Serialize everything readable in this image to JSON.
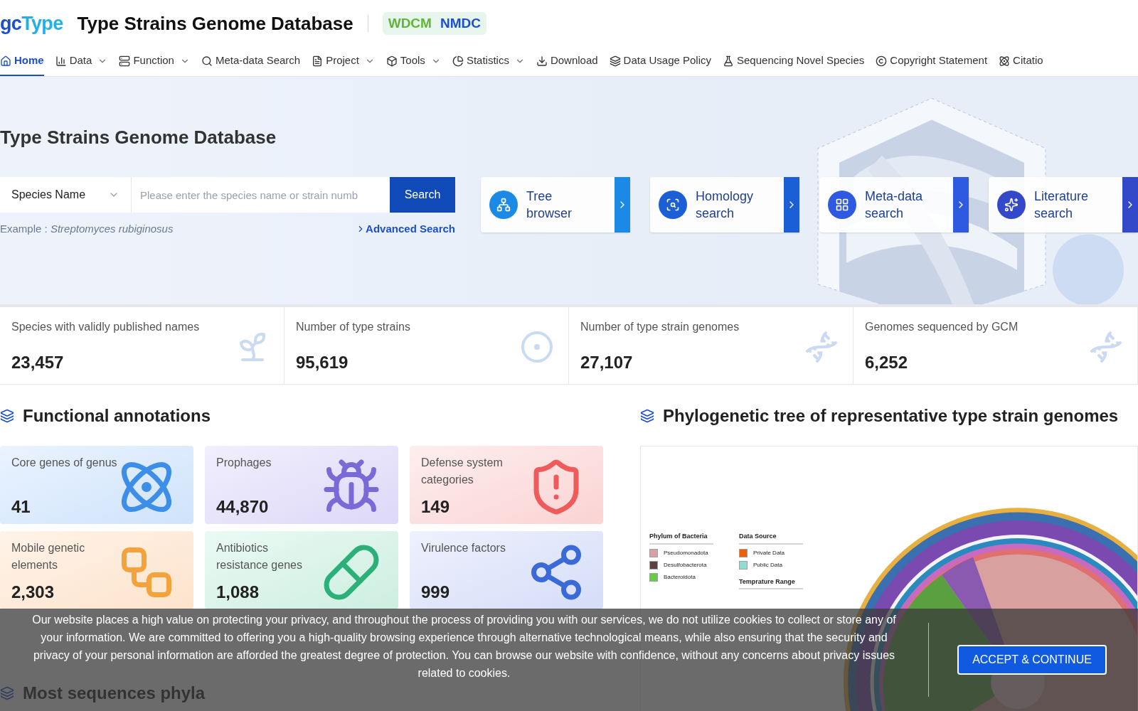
{
  "brand": {
    "logo_a": "gc",
    "logo_b": "Type",
    "title": "Type Strains Genome Database",
    "badges": [
      "WDCM",
      "NMDC"
    ]
  },
  "nav": [
    {
      "label": "Home",
      "dropdown": false,
      "selected": true
    },
    {
      "label": "Data",
      "dropdown": true,
      "selected": false
    },
    {
      "label": "Function",
      "dropdown": true,
      "selected": false
    },
    {
      "label": "Meta-data Search",
      "dropdown": false,
      "selected": false
    },
    {
      "label": "Project",
      "dropdown": true,
      "selected": false
    },
    {
      "label": "Tools",
      "dropdown": true,
      "selected": false
    },
    {
      "label": "Statistics",
      "dropdown": true,
      "selected": false
    },
    {
      "label": "Download",
      "dropdown": false,
      "selected": false
    },
    {
      "label": "Data Usage Policy",
      "dropdown": false,
      "selected": false
    },
    {
      "label": "Sequencing Novel Species",
      "dropdown": false,
      "selected": false
    },
    {
      "label": "Copyright Statement",
      "dropdown": false,
      "selected": false
    },
    {
      "label": "Citatio",
      "dropdown": false,
      "selected": false
    }
  ],
  "hero": {
    "title": "Type Strains Genome Database",
    "search_type": "Species Name",
    "placeholder": "Please enter the species name or strain numb",
    "search_button": "Search",
    "example_label": "Example : ",
    "example": "Streptomyces rubiginosus",
    "advanced": "Advanced Search"
  },
  "shortcuts": [
    {
      "label": "Tree browser",
      "color": "#1a8ae6"
    },
    {
      "label": "Homology search",
      "color": "#1a5fd6"
    },
    {
      "label": "Meta-data search",
      "color": "#2d5ae0"
    },
    {
      "label": "Literature search",
      "color": "#3349c9"
    }
  ],
  "stats": [
    {
      "label": "Species with validly published names",
      "value": "23,457"
    },
    {
      "label": "Number of type strains",
      "value": "95,619"
    },
    {
      "label": "Number of type strain genomes",
      "value": "27,107"
    },
    {
      "label": "Genomes sequenced by GCM",
      "value": "6,252"
    }
  ],
  "functional": {
    "title": "Functional annotations",
    "cards": [
      {
        "label": "Core genes of genus",
        "value": "41"
      },
      {
        "label": "Prophages",
        "value": "44,870"
      },
      {
        "label": "Defense system categories",
        "value": "149"
      },
      {
        "label": "Mobile genetic elements",
        "value": "2,303"
      },
      {
        "label": "Antibiotics resistance genes",
        "value": "1,088"
      },
      {
        "label": "Virulence factors",
        "value": "999"
      }
    ]
  },
  "phylo": {
    "title": "Phylogenetic tree of representative type strain genomes",
    "legends": [
      {
        "title": "Phylum of Bacteria",
        "items": [
          {
            "label": "Pseudomonadota",
            "color": "#d9a0a0"
          },
          {
            "label": "Desulfobacterota",
            "color": "#5a4040"
          },
          {
            "label": "Bacteroidota",
            "color": "#66cc44"
          }
        ]
      },
      {
        "title": "Data Source",
        "items": [
          {
            "label": "Private Data",
            "color": "#f06000"
          },
          {
            "label": "Public Data",
            "color": "#90dcd0"
          }
        ]
      },
      {
        "title": "Temprature Range"
      }
    ]
  },
  "most": {
    "title": "Most sequences phyla"
  },
  "cookie": {
    "text": "Our website places a high value on protecting your privacy, and throughout the process of providing you with our services, we do not utilize cookies to collect or store any of your information. We are committed to offering you a high-quality browsing experience through alternative technological means, while also ensuring that the security and privacy of your personal information are afforded the greatest degree of protection. You can browse our website with confidence, without any concerns about privacy issues related to cookies.",
    "button": "ACCEPT & CONTINUE"
  }
}
